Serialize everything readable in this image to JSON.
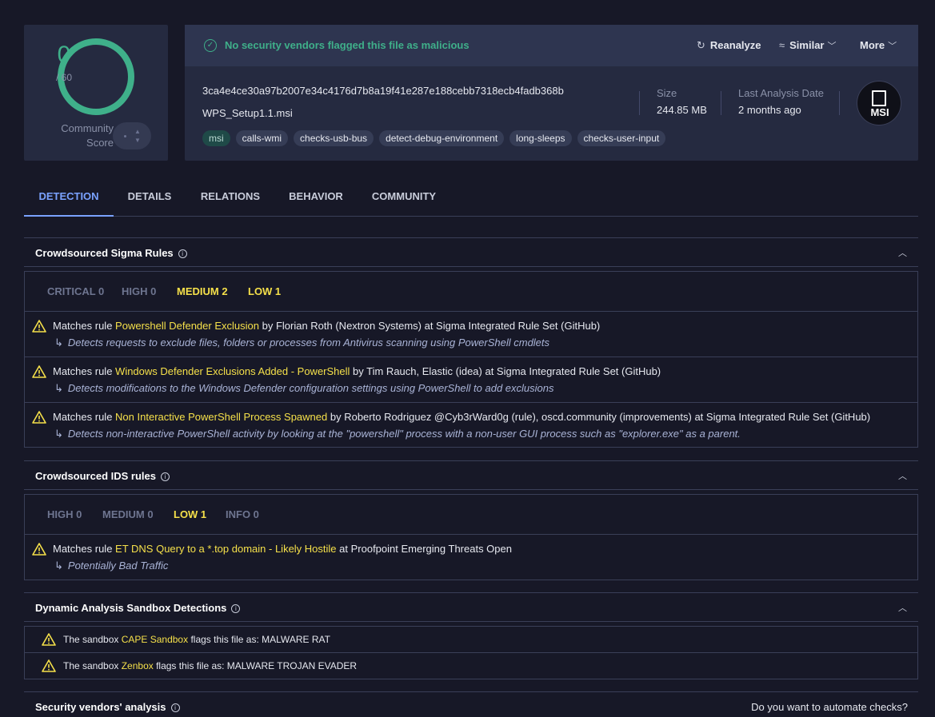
{
  "score": {
    "detections": "0",
    "total": "/ 60",
    "community_label_1": "Community",
    "community_label_2": "Score",
    "ring_color": "#3fb08a"
  },
  "file": {
    "status": "No security vendors flagged this file as malicious",
    "hash": "3ca4e4ce30a97b2007e34c4176d7b8a19f41e287e188cebb7318ecb4fadb368b",
    "name": "WPS_Setup1.1.msi",
    "tags": [
      "msi",
      "calls-wmi",
      "checks-usb-bus",
      "detect-debug-environment",
      "long-sleeps",
      "checks-user-input"
    ],
    "size_label": "Size",
    "size_value": "244.85 MB",
    "date_label": "Last Analysis Date",
    "date_value": "2 months ago",
    "type_badge": "MSI"
  },
  "actions": {
    "reanalyze": "Reanalyze",
    "similar": "Similar",
    "more": "More"
  },
  "tabs": [
    "DETECTION",
    "DETAILS",
    "RELATIONS",
    "BEHAVIOR",
    "COMMUNITY"
  ],
  "sigma": {
    "title": "Crowdsourced Sigma Rules",
    "severities": [
      "CRITICAL 0",
      "HIGH 0",
      "MEDIUM 2",
      "LOW 1"
    ],
    "rules": [
      {
        "prefix": "Matches rule ",
        "name": "Powershell Defender Exclusion",
        "suffix": " by Florian Roth (Nextron Systems) at Sigma Integrated Rule Set (GitHub)",
        "desc": "Detects requests to exclude files, folders or processes from Antivirus scanning using PowerShell cmdlets"
      },
      {
        "prefix": "Matches rule ",
        "name": "Windows Defender Exclusions Added - PowerShell",
        "suffix": " by Tim Rauch, Elastic (idea) at Sigma Integrated Rule Set (GitHub)",
        "desc": "Detects modifications to the Windows Defender configuration settings using PowerShell to add exclusions"
      },
      {
        "prefix": "Matches rule ",
        "name": "Non Interactive PowerShell Process Spawned",
        "suffix": " by Roberto Rodriguez @Cyb3rWard0g (rule), oscd.community (improvements) at Sigma Integrated Rule Set (GitHub)",
        "desc": "Detects non-interactive PowerShell activity by looking at the \"powershell\" process with a non-user GUI process such as \"explorer.exe\" as a parent."
      }
    ]
  },
  "ids": {
    "title": "Crowdsourced IDS rules",
    "severities": [
      "HIGH 0",
      "MEDIUM 0",
      "LOW 1",
      "INFO 0"
    ],
    "rules": [
      {
        "prefix": "Matches rule ",
        "name": "ET DNS Query to a *.top domain - Likely Hostile",
        "suffix": " at Proofpoint Emerging Threats Open",
        "desc": "Potentially Bad Traffic"
      }
    ]
  },
  "sandbox": {
    "title": "Dynamic Analysis Sandbox Detections",
    "rows": [
      {
        "prefix": "The sandbox ",
        "name": "CAPE Sandbox",
        "suffix": " flags this file as: MALWARE RAT"
      },
      {
        "prefix": "The sandbox ",
        "name": "Zenbox",
        "suffix": " flags this file as: MALWARE TROJAN EVADER"
      }
    ]
  },
  "vendors": {
    "title": "Security vendors' analysis",
    "automate": "Do you want to automate checks?"
  },
  "colors": {
    "background": "#171827",
    "card": "#252a40",
    "clean_green": "#3fb08a",
    "highlight_yellow": "#f5e04a",
    "active_tab_blue": "#7aa2ff"
  }
}
